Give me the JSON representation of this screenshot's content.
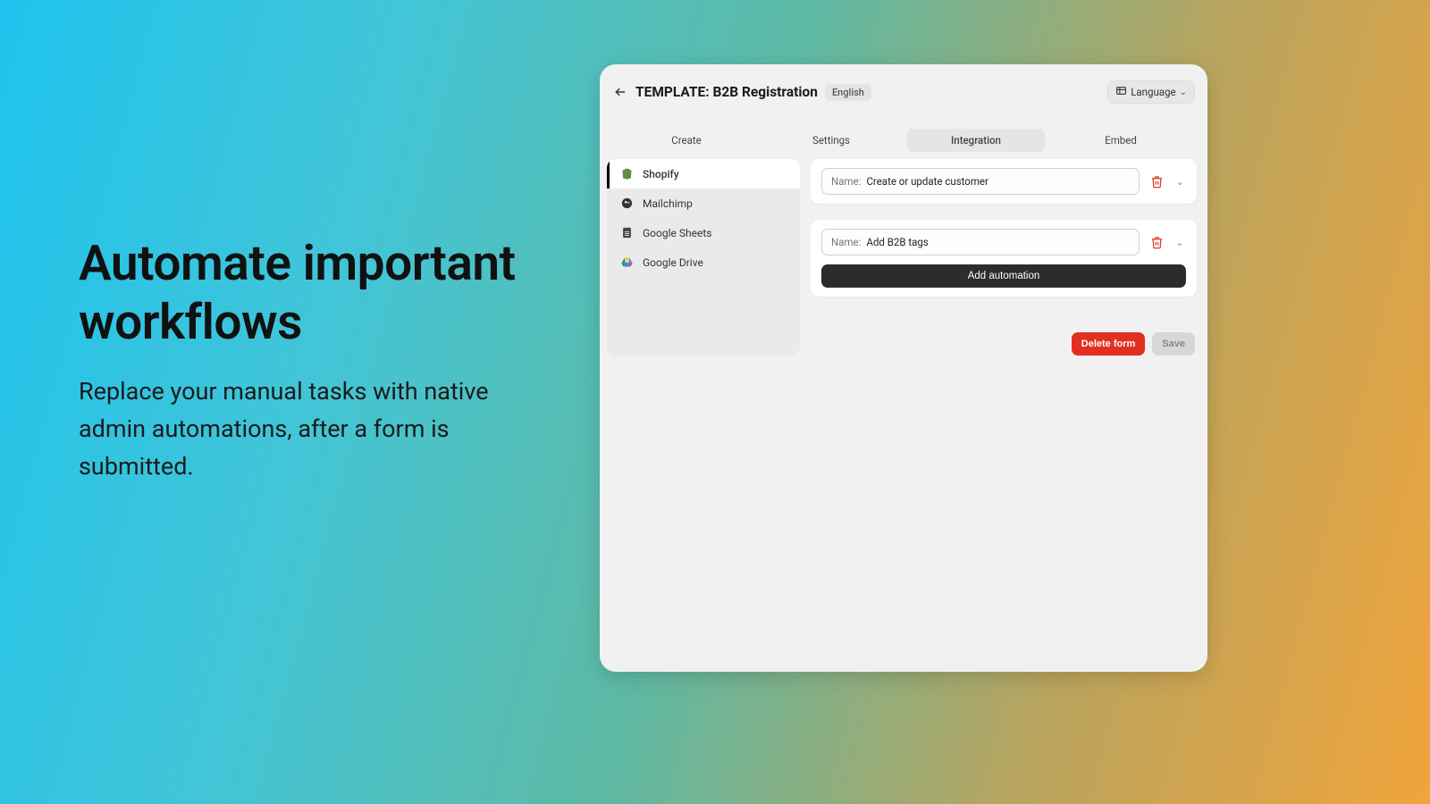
{
  "marketing": {
    "headline": "Automate important workflows",
    "subhead": "Replace your manual tasks with native admin automations, after a form is submitted."
  },
  "header": {
    "title": "TEMPLATE: B2B Registration",
    "badge": "English",
    "language_label": "Language"
  },
  "tabs": {
    "create": "Create",
    "settings": "Settings",
    "integration": "Integration",
    "embed": "Embed"
  },
  "sidebar": {
    "items": [
      {
        "label": "Shopify"
      },
      {
        "label": "Mailchimp"
      },
      {
        "label": "Google Sheets"
      },
      {
        "label": "Google Drive"
      }
    ]
  },
  "automations": {
    "name_label": "Name:",
    "rows": [
      {
        "value": "Create or update customer"
      },
      {
        "value": "Add B2B tags"
      }
    ],
    "add_label": "Add automation"
  },
  "footer": {
    "delete": "Delete form",
    "save": "Save"
  }
}
